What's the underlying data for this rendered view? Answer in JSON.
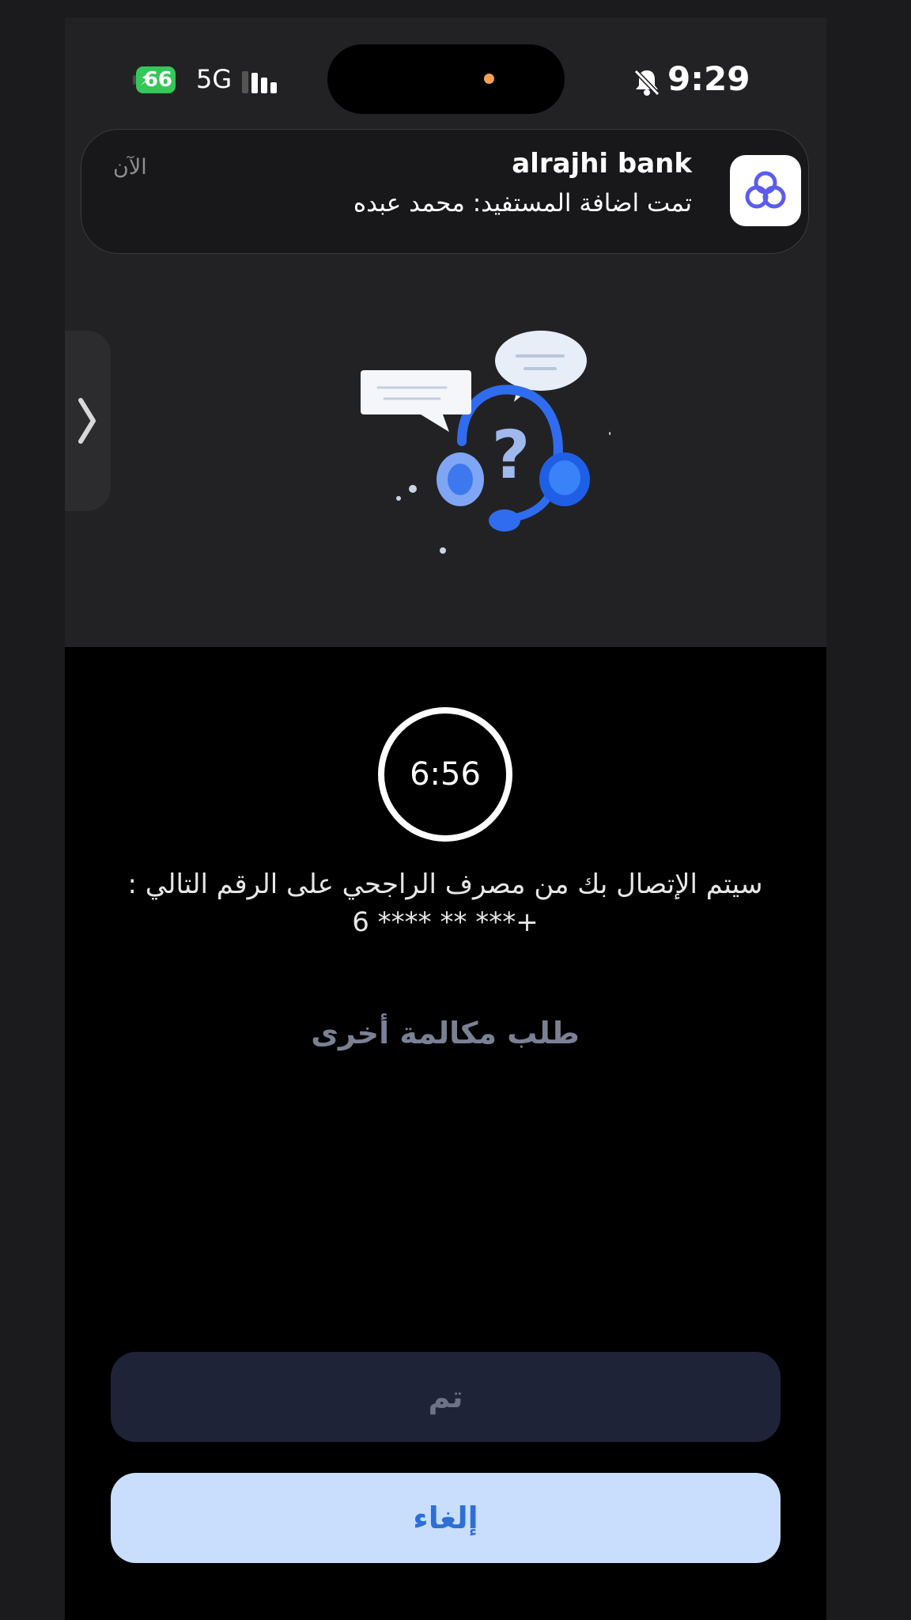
{
  "status_bar": {
    "battery": "66",
    "network": "5G",
    "time": "9:29",
    "icons": [
      "battery-charging-icon",
      "signal-icon",
      "silent-bell-icon"
    ]
  },
  "notification": {
    "app_name": "alrajhi bank",
    "message": "تمت اضافة المستفيد: محمد عبده",
    "time": "الآن",
    "icon": "alrajhi-logo-icon"
  },
  "call": {
    "timer": "6:56",
    "message": "سيتم الإتصال بك من مصرف الراجحي على الرقم التالي : +*** ** **** 6",
    "request_another_call": "طلب مكالمة أخرى"
  },
  "buttons": {
    "done": "تم",
    "cancel": "إلغاء"
  },
  "colors": {
    "accent": "#2d6fd6",
    "cancel_bg": "#c9defc",
    "done_bg": "#1f2338",
    "battery": "#34c759",
    "illustration_blue": "#2f6cf0"
  }
}
